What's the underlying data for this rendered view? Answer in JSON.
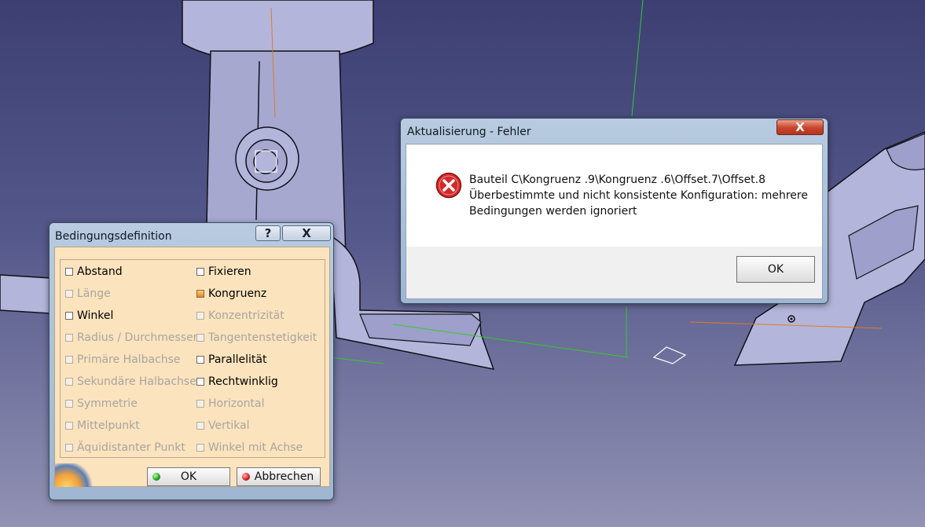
{
  "constraint_dialog": {
    "title": "Bedingungsdefinition",
    "help_label": "?",
    "close_label": "X",
    "options_left": [
      {
        "label": "Abstand",
        "enabled": true
      },
      {
        "label": "Länge",
        "enabled": false
      },
      {
        "label": "Winkel",
        "enabled": true
      },
      {
        "label": "Radius / Durchmesser",
        "enabled": false
      },
      {
        "label": "Primäre Halbachse",
        "enabled": false
      },
      {
        "label": "Sekundäre Halbachse",
        "enabled": false
      },
      {
        "label": "Symmetrie",
        "enabled": false
      },
      {
        "label": "Mittelpunkt",
        "enabled": false
      },
      {
        "label": "Äquidistanter Punkt",
        "enabled": false
      }
    ],
    "options_right": [
      {
        "label": "Fixieren",
        "enabled": true
      },
      {
        "label": "Kongruenz",
        "enabled": true,
        "active": true
      },
      {
        "label": "Konzentrizität",
        "enabled": false
      },
      {
        "label": "Tangentenstetigkeit",
        "enabled": false
      },
      {
        "label": "Parallelität",
        "enabled": true
      },
      {
        "label": "Rechtwinklig",
        "enabled": true
      },
      {
        "label": "Horizontal",
        "enabled": false
      },
      {
        "label": "Vertikal",
        "enabled": false
      },
      {
        "label": "Winkel mit Achse",
        "enabled": false
      }
    ],
    "ok_label": "OK",
    "cancel_label": "Abbrechen"
  },
  "error_dialog": {
    "title": "Aktualisierung - Fehler",
    "close_label": "X",
    "message_lines": [
      "Bauteil C\\Kongruenz .9\\Kongruenz .6\\Offset.7\\Offset.8",
      "Überbestimmte und nicht konsistente Konfiguration: mehrere",
      "Bedingungen werden ignoriert"
    ],
    "ok_label": "OK"
  },
  "colors": {
    "viewport_top": "#3d3f73",
    "viewport_bottom": "#9292b4",
    "part_fill": "#b4b5da",
    "panel_fill": "#fbe3bd",
    "axis_green": "#2ecc2e",
    "axis_orange": "#e07a2a"
  },
  "icons": {
    "error": "error-icon",
    "ok_status": "green-dot-icon",
    "cancel_status": "red-dot-icon"
  }
}
